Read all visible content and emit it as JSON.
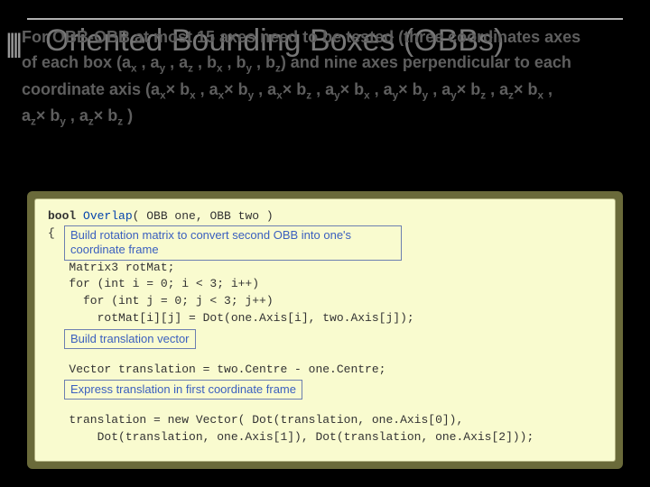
{
  "title": "Oriented Bounding Boxes (OBBs)",
  "body": {
    "line1_prefix": "For OBB-OBB at most 15 axes need to be tested (three coordinates axes",
    "line2": "of each box (aₓ , aᵧ , a_z , bₓ , bᵧ , b_z) and nine axes perpendicular to each",
    "line3": "coordinate axis (aₓ× bₓ  , aₓ× bᵧ  , aₓ× b_z  , aᵧ× bₓ  , aᵧ× bᵧ  , aᵧ× b_z  , a_z× bₓ  ,",
    "line4": "a_z× bᵧ  , a_z× b_z )"
  },
  "annotations": {
    "a1": "Build rotation matrix to convert second OBB into one's coordinate frame",
    "a2": "Build translation vector",
    "a3": "Express translation in first coordinate frame"
  },
  "code": {
    "sig_pre": "bool ",
    "sig_name": "Overlap",
    "sig_rest": "( OBB one, OBB two )",
    "open_brace": "{",
    "l_rotmat": "   Matrix3 rotMat;",
    "l_for_i": "   for (int i = 0; i < 3; i++)",
    "l_for_j": "     for (int j = 0; j < 3; j++)",
    "l_dot": "       rotMat[i][j] = Dot(one.Axis[i], two.Axis[j]);",
    "l_blank": "",
    "l_trans": "   Vector translation = two.Centre - one.Centre;",
    "l_blank2": "",
    "l_texp1": "   translation = new Vector( Dot(translation, one.Axis[0]),",
    "l_texp2": "       Dot(translation, one.Axis[1]), Dot(translation, one.Axis[2]));"
  }
}
